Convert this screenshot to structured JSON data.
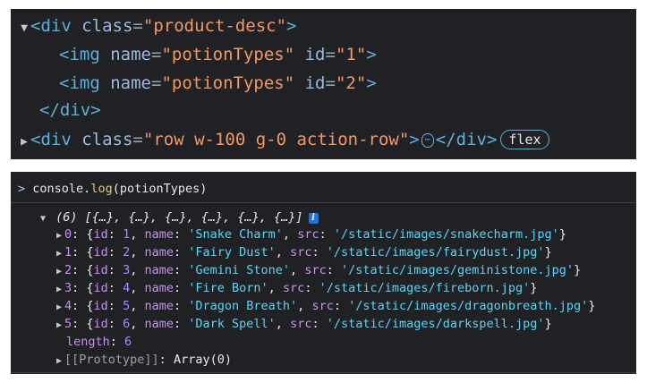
{
  "elements_panel": {
    "lines": [
      {
        "tag_open": "<div",
        "attr": "class",
        "value": "\"product-desc\"",
        "close": ">"
      },
      {
        "tag_open": "<img",
        "attr1": "name",
        "value1": "\"potionTypes\"",
        "attr2": "id",
        "value2": "\"1\"",
        "close": ">"
      },
      {
        "tag_open": "<img",
        "attr1": "name",
        "value1": "\"potionTypes\"",
        "attr2": "id",
        "value2": "\"2\"",
        "close": ">"
      },
      {
        "text": "</div>"
      },
      {
        "tag_open": "<div",
        "attr": "class",
        "value": "\"row w-100 g-0 action-row\"",
        "close": ">",
        "ellipsis": "⋯",
        "tag_close": "</div>",
        "badge": "flex"
      }
    ]
  },
  "console_panel": {
    "input": {
      "obj": "console.",
      "method": "log",
      "args": "(potionTypes)"
    },
    "summary": {
      "count": "(6)",
      "preview": "[{…}, {…}, {…}, {…}, {…}, {…}]",
      "info": "i"
    },
    "items": [
      {
        "index": "0",
        "id": "1",
        "name": "'Snake Charm'",
        "src": "'/static/images/snakecharm.jpg'"
      },
      {
        "index": "1",
        "id": "2",
        "name": "'Fairy Dust'",
        "src": "'/static/images/fairydust.jpg'"
      },
      {
        "index": "2",
        "id": "3",
        "name": "'Gemini Stone'",
        "src": "'/static/images/geministone.jpg'"
      },
      {
        "index": "3",
        "id": "4",
        "name": "'Fire Born'",
        "src": "'/static/images/fireborn.jpg'"
      },
      {
        "index": "4",
        "id": "5",
        "name": "'Dragon Breath'",
        "src": "'/static/images/dragonbreath.jpg'"
      },
      {
        "index": "5",
        "id": "6",
        "name": "'Dark Spell'",
        "src": "'/static/images/darkspell.jpg'"
      }
    ],
    "length_label": "length",
    "length_value": "6",
    "prototype_label": "[[Prototype]]",
    "prototype_value": "Array(0)"
  }
}
